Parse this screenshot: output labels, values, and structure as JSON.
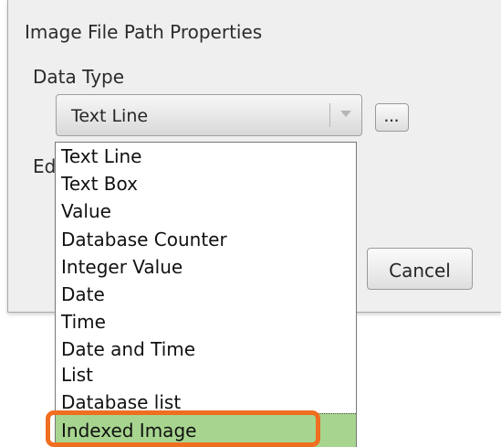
{
  "dialog": {
    "title": "Image File Path Properties",
    "data_type_label": "Data Type",
    "edit_label_partial": "Ed",
    "browse_button_label": "...",
    "cancel_button_label": "Cancel",
    "combo": {
      "selected_value": "Text Line"
    }
  },
  "dropdown": {
    "items": [
      {
        "label": "Text Line"
      },
      {
        "label": "Text Box"
      },
      {
        "label": "Value"
      },
      {
        "label": "Database Counter"
      },
      {
        "label": "Integer Value"
      },
      {
        "label": "Date"
      },
      {
        "label": "Time"
      },
      {
        "label": "Date and Time"
      },
      {
        "label": "List"
      },
      {
        "label": "Database list"
      }
    ],
    "highlighted_item": {
      "label": "Indexed Image"
    }
  },
  "colors": {
    "highlight": "#a7d58f",
    "annotation_outline": "#f06e1f"
  }
}
